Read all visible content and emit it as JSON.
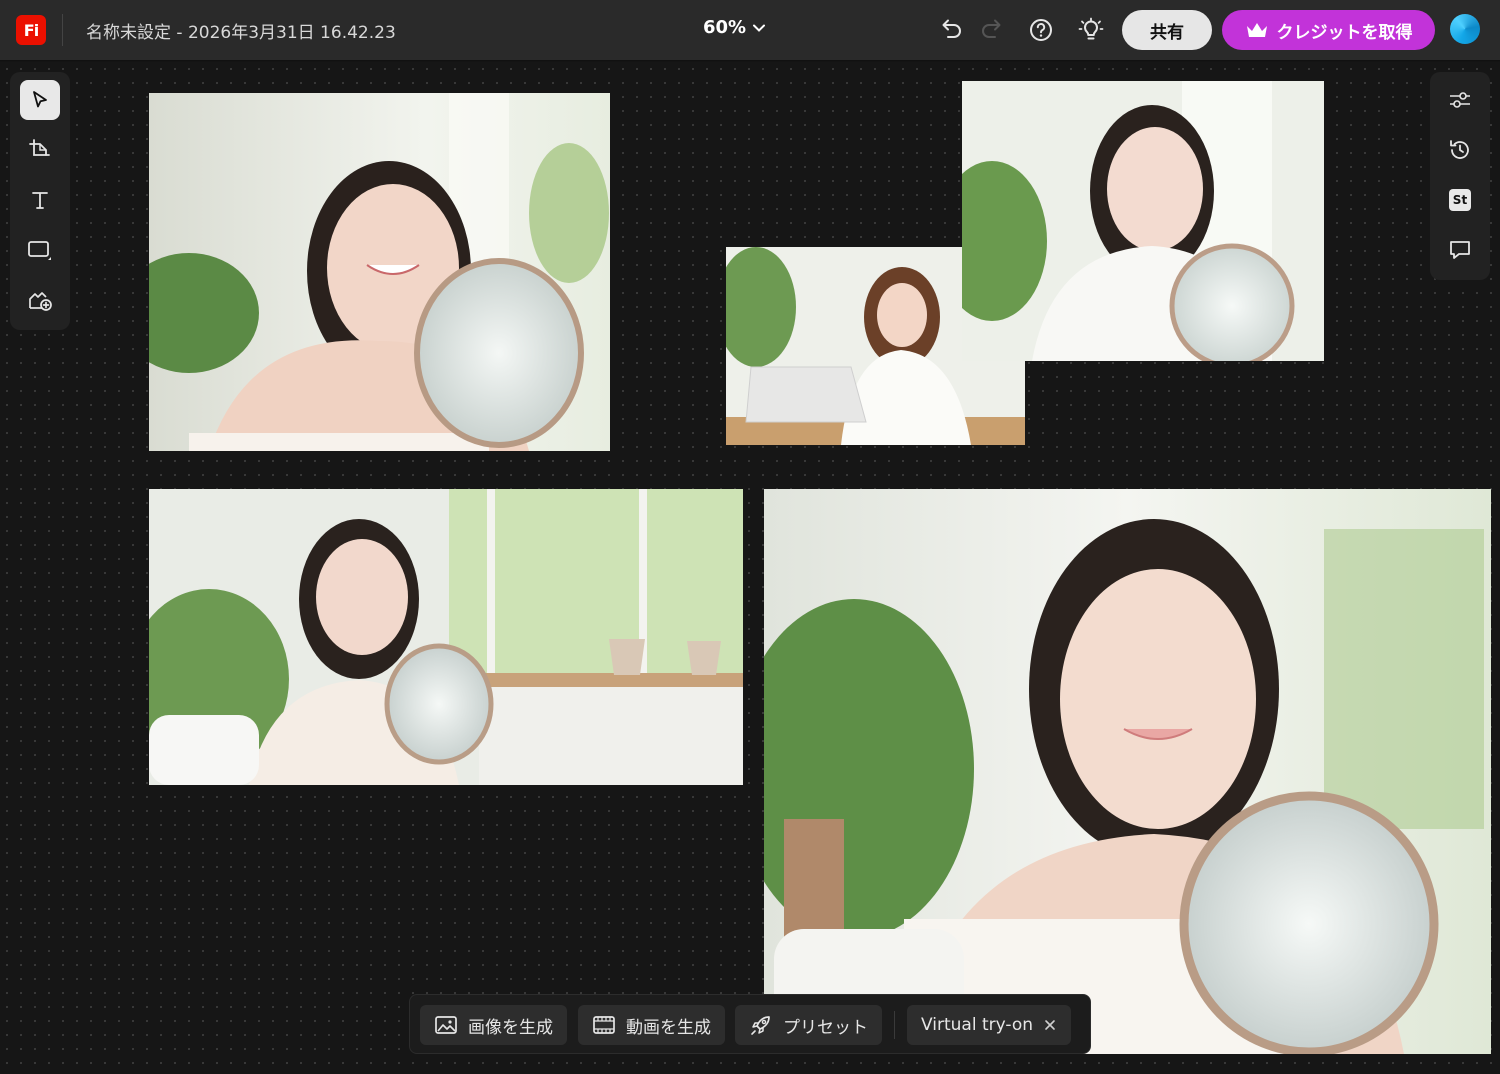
{
  "app": {
    "logo_text": "Fi",
    "logo_color": "#eb1000"
  },
  "header": {
    "doc_title": "名称未設定 - 2026年3月31日 16.42.23",
    "zoom_level": "60%",
    "share_label": "共有",
    "credit_label": "クレジットを取得",
    "credit_color": "#c233d9",
    "icons": [
      "undo-icon",
      "redo-icon",
      "help-icon",
      "lightbulb-icon",
      "crown-icon"
    ]
  },
  "left_toolbar": {
    "tools": [
      "select-tool",
      "artboard-tool",
      "text-tool",
      "shape-tool",
      "image-add-tool"
    ],
    "active": "select-tool"
  },
  "right_toolbar": {
    "tools": [
      "adjust-icon",
      "history-icon",
      "stock-icon",
      "comment-icon"
    ],
    "stock_label": "St"
  },
  "canvas": {
    "images": [
      "woman-mirror-smile",
      "woman-laptop",
      "woman-hand-chin-mirror",
      "woman-mirror-window",
      "woman-mirror-closeup"
    ]
  },
  "bottom_bar": {
    "generate_image_label": "画像を生成",
    "generate_video_label": "動画を生成",
    "preset_label": "プリセット",
    "virtual_tryon_label": "Virtual try-on"
  }
}
